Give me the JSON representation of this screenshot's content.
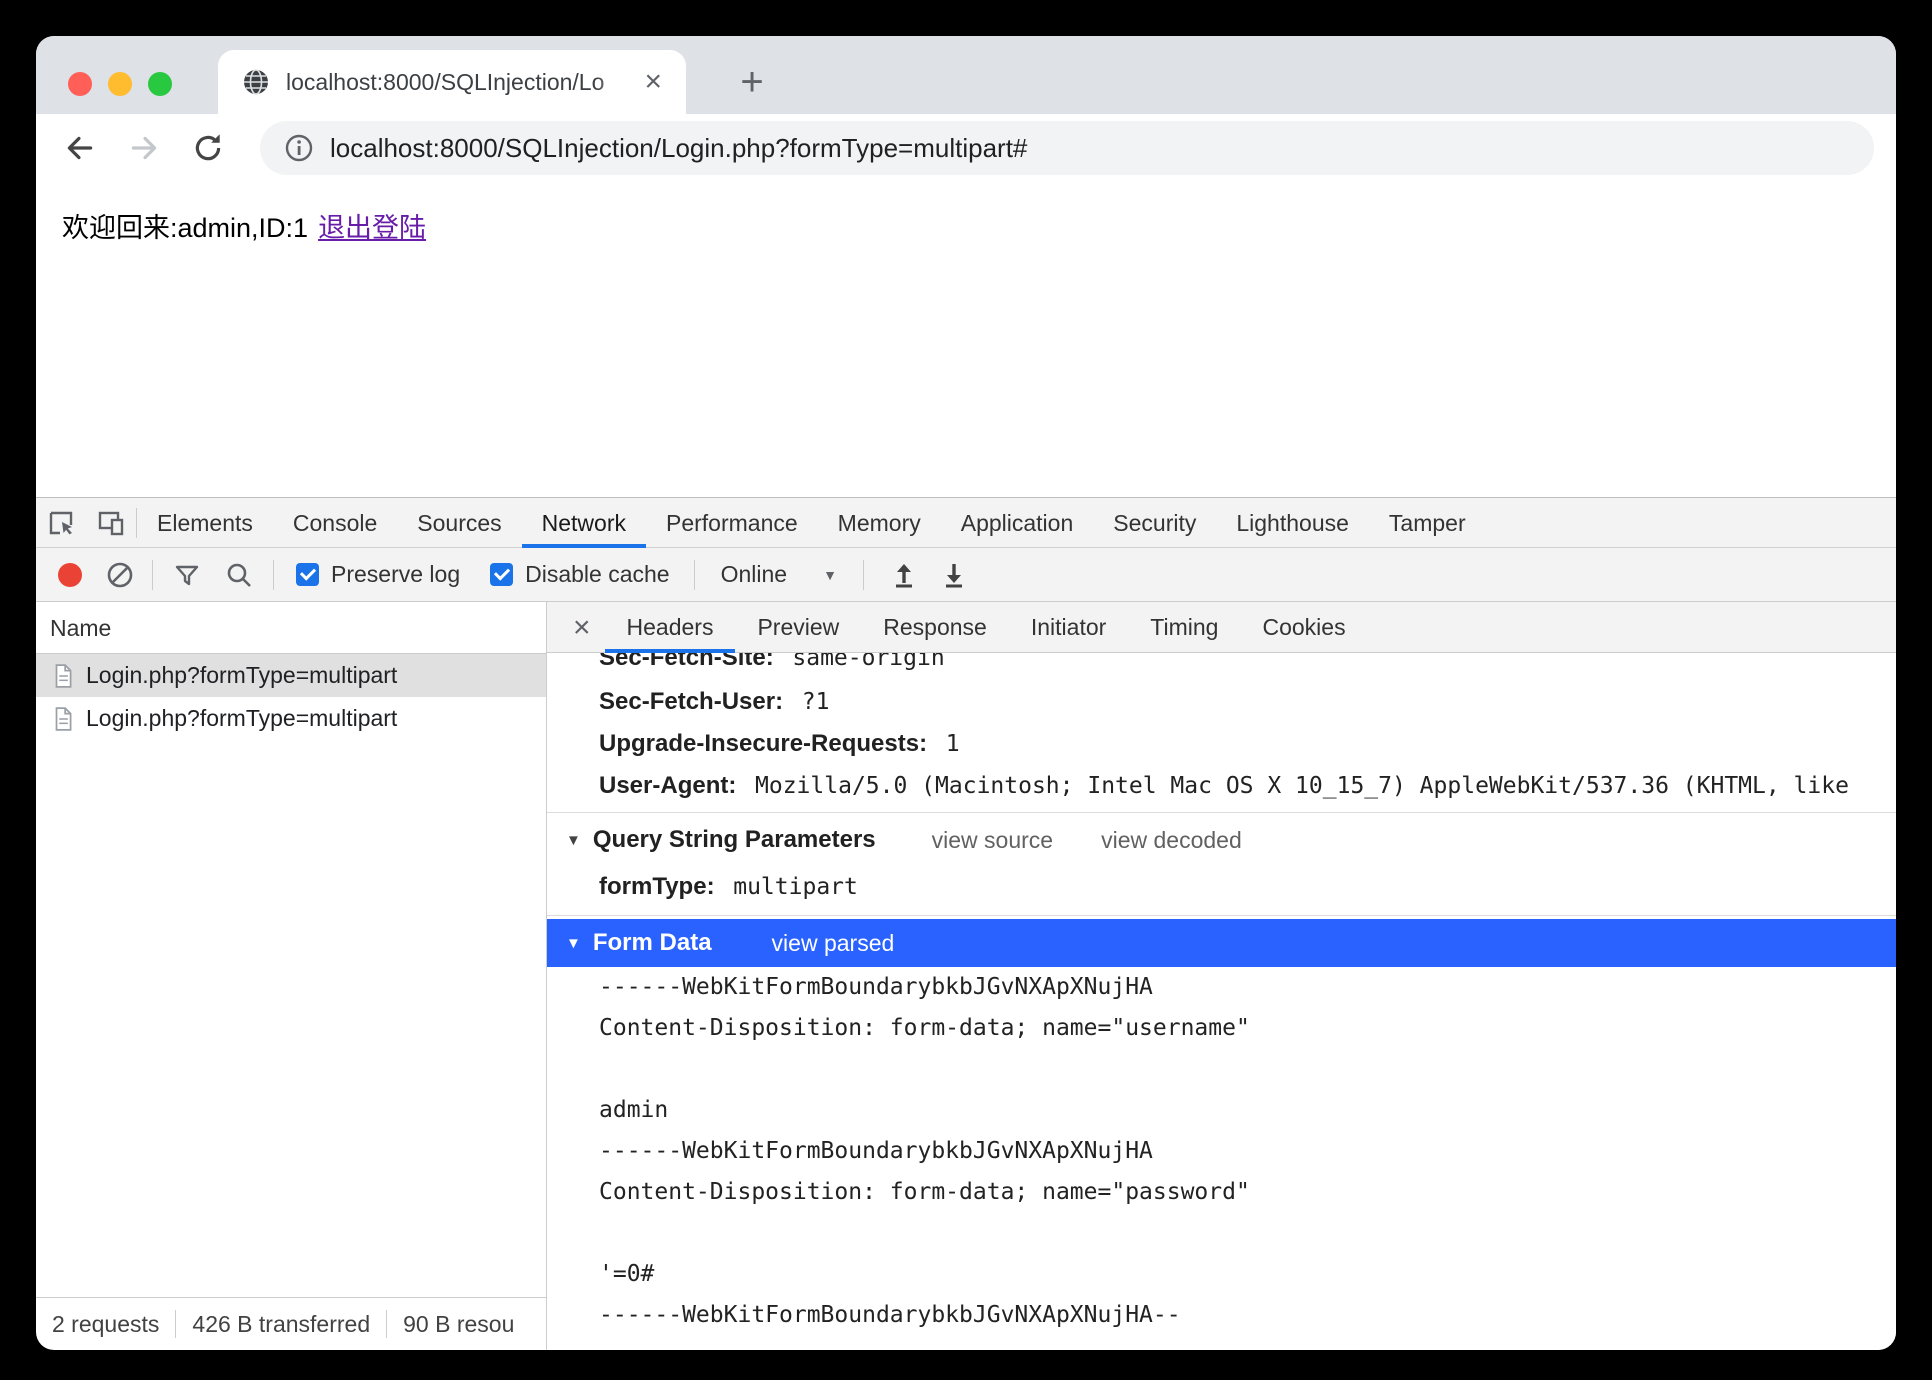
{
  "icons": {
    "close_tab": "×",
    "new_tab": "+",
    "detail_close": "×",
    "caret": "▼"
  },
  "browser": {
    "tab_title": "localhost:8000/SQLInjection/Lo",
    "url": "localhost:8000/SQLInjection/Login.php?formType=multipart#"
  },
  "page": {
    "welcome": "欢迎回来:admin,ID:1",
    "logout": "退出登陆"
  },
  "devtools": {
    "tabs": [
      "Elements",
      "Console",
      "Sources",
      "Network",
      "Performance",
      "Memory",
      "Application",
      "Security",
      "Lighthouse",
      "Tamper"
    ],
    "active_tab": "Network",
    "net_toolbar": {
      "preserve_log": "Preserve log",
      "disable_cache": "Disable cache",
      "online": "Online"
    },
    "request_list": {
      "column_header": "Name",
      "rows": [
        "Login.php?formType=multipart",
        "Login.php?formType=multipart"
      ]
    },
    "status_bar": {
      "requests": "2 requests",
      "transferred": "426 B transferred",
      "resources": "90 B resou"
    },
    "details": {
      "tabs": [
        "Headers",
        "Preview",
        "Response",
        "Initiator",
        "Timing",
        "Cookies"
      ],
      "active_tab": "Headers",
      "headers": [
        {
          "name": "Sec-Fetch-Site:",
          "value": "same-origin"
        },
        {
          "name": "Sec-Fetch-User:",
          "value": "?1"
        },
        {
          "name": "Upgrade-Insecure-Requests:",
          "value": "1"
        },
        {
          "name": "User-Agent:",
          "value": "Mozilla/5.0 (Macintosh; Intel Mac OS X 10_15_7) AppleWebKit/537.36 (KHTML, like"
        }
      ],
      "query_string": {
        "title": "Query String Parameters",
        "view_source": "view source",
        "view_decoded": "view decoded",
        "param_name": "formType:",
        "param_value": "multipart"
      },
      "form_data": {
        "title": "Form Data",
        "view_parsed": "view parsed",
        "lines": [
          "------WebKitFormBoundarybkbJGvNXApXNujHA",
          "Content-Disposition: form-data; name=\"username\"",
          "",
          "admin",
          "------WebKitFormBoundarybkbJGvNXApXNujHA",
          "Content-Disposition: form-data; name=\"password\"",
          "",
          "'=0#",
          "------WebKitFormBoundarybkbJGvNXApXNujHA--"
        ]
      }
    }
  }
}
